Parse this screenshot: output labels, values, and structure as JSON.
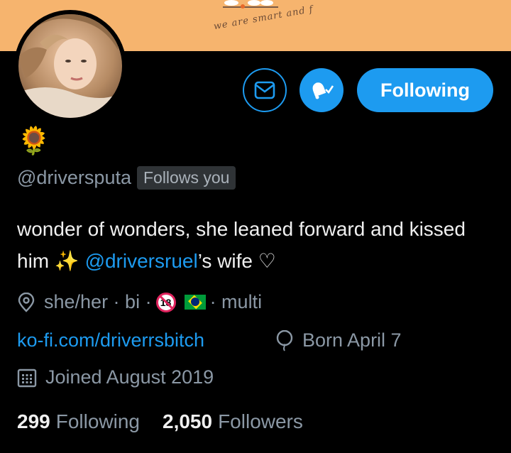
{
  "banner": {
    "text": "we are smart and f"
  },
  "profile": {
    "emoji": "🌻",
    "handle": "@driversputa",
    "follows_you": "Follows you",
    "bio_line1": "wonder of wonders, she leaned forward and kissed",
    "bio_him": "him",
    "bio_sparkle": "✨",
    "bio_mention": "@driversruel",
    "bio_tail": "’s wife ♡",
    "location_pre": "she/her · bi ·",
    "location_18": "18",
    "location_post": "· multi",
    "website": "ko-fi.com/driverrsbitch",
    "birthday": "Born April 7",
    "joined": "Joined August 2019"
  },
  "actions": {
    "follow_label": "Following"
  },
  "stats": {
    "following_count": "299",
    "following_label": "Following",
    "followers_count": "2,050",
    "followers_label": "Followers"
  },
  "colors": {
    "accent": "#1d9bf0",
    "banner": "#f6b46e",
    "background": "#000000"
  },
  "icons": [
    "envelope-icon",
    "bell-check-icon",
    "location-pin-icon",
    "balloon-icon",
    "calendar-icon"
  ]
}
